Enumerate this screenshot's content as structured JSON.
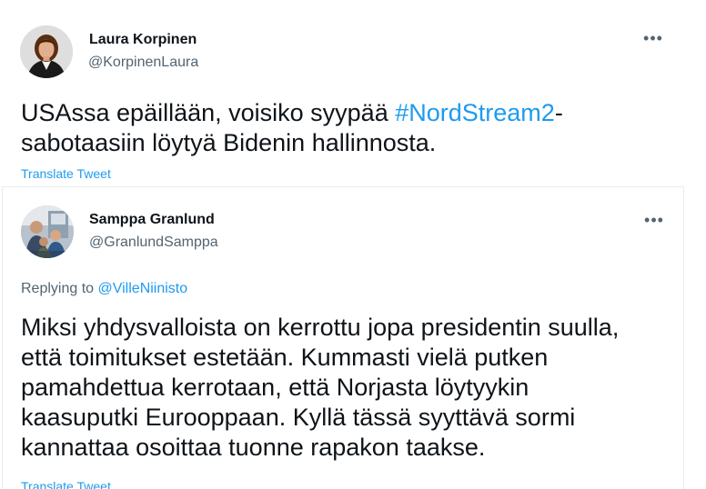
{
  "tweet_1": {
    "author_name": "Laura Korpinen",
    "author_handle": "@KorpinenLaura",
    "more_icon": "more-horizontal-icon",
    "more_glyph": "•••",
    "text_line_1_before": "USAssa epäillään, voisiko syypää ",
    "hashtag": "#NordStream2",
    "text_line_1_after": "-",
    "text_line_2": "sabotaasiin löytyä Bidenin hallinnosta.",
    "translate_label": "Translate Tweet"
  },
  "tweet_2": {
    "author_name": "Samppa Granlund",
    "author_handle": "@GranlundSamppa",
    "more_icon": "more-horizontal-icon",
    "more_glyph": "•••",
    "replying_prefix": "Replying to ",
    "replying_mention": "@VilleNiinisto",
    "text_lines": [
      "Miksi yhdysvalloista on kerrottu jopa presidentin suulla,",
      "että toimitukset estetään. Kummasti vielä putken",
      "pamahdettua kerrotaan, että Norjasta löytyykin",
      "kaasuputki Eurooppaan. Kyllä tässä syyttävä sormi",
      "kannattaa osoittaa tuonne rapakon taakse."
    ],
    "translate_label": "Translate Tweet"
  },
  "colors": {
    "link_blue": "#1d9bf0",
    "text_primary": "#0f1419",
    "text_secondary": "#536471",
    "divider": "#e6ecf0"
  }
}
